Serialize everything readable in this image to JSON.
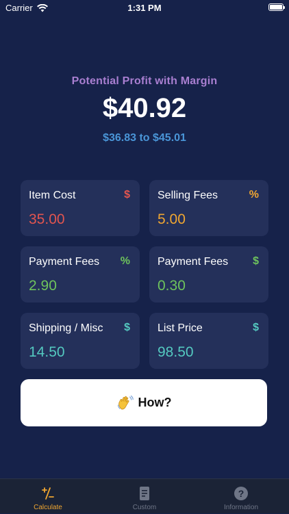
{
  "status_bar": {
    "carrier": "Carrier",
    "time": "1:31 PM"
  },
  "header": {
    "profit_label": "Potential Profit with Margin",
    "profit_value": "$40.92",
    "profit_range": "$36.83 to $45.01"
  },
  "colors": {
    "background": "#16224a",
    "card": "#24305a",
    "red": "#e2554f",
    "orange": "#f0a631",
    "green": "#6ec35c",
    "teal": "#54c9c0",
    "tab_active": "#f0a631",
    "tab_inactive": "#6f7687"
  },
  "fields": [
    {
      "label": "Item Cost",
      "unit": "$",
      "value": "35.00"
    },
    {
      "label": "Selling Fees",
      "unit": "%",
      "value": "5.00"
    },
    {
      "label": "Payment Fees",
      "unit": "%",
      "value": "2.90"
    },
    {
      "label": "Payment Fees",
      "unit": "$",
      "value": "0.30"
    },
    {
      "label": "Shipping / Misc",
      "unit": "$",
      "value": "14.50"
    },
    {
      "label": "List Price",
      "unit": "$",
      "value": "98.50"
    }
  ],
  "how_button": {
    "icon": "waving-hand-icon",
    "label": "How?"
  },
  "tabs": [
    {
      "label": "Calculate",
      "icon": "plus-minus-icon",
      "active": true
    },
    {
      "label": "Custom",
      "icon": "document-icon",
      "active": false
    },
    {
      "label": "Information",
      "icon": "question-icon",
      "active": false
    }
  ]
}
